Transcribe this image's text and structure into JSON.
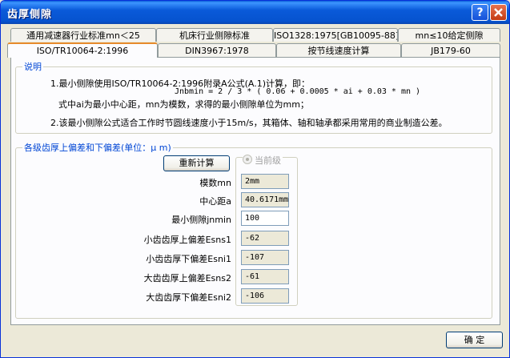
{
  "window": {
    "title": "齿厚侧隙"
  },
  "tabs": {
    "row1": [
      "通用减速器行业标准mn＜25",
      "机床行业侧隙标准",
      "ISO1328:1975[GB10095-88]",
      "mn≤10给定侧隙"
    ],
    "row2": [
      "ISO/TR10064-2:1996",
      "DIN3967:1978",
      "按节线速度计算",
      "JB179-60"
    ]
  },
  "notes": {
    "group_title": "说明",
    "line1": "1.最小侧隙使用ISO/TR10064-2:1996附录A公式(A.1)计算，即：",
    "formula": "Jnbmin = 2 / 3 * ( 0.06 + 0.0005 * ai + 0.03 * mn )",
    "line2": "式中ai为最小中心距，mn为模数，求得的最小侧隙单位为mm；",
    "line3": "2.该最小侧隙公式适合工作时节圆线速度小于15m/s，其箱体、轴和轴承都采用常用的商业制造公差。"
  },
  "deviation": {
    "group_title": "各级齿厚上偏差和下偏差(单位：μ m)",
    "recalc_button": "重新计算",
    "radio_label": "当前级",
    "fields": [
      {
        "label": "模数mn",
        "value": "2mm",
        "editable": false
      },
      {
        "label": "中心距a",
        "value": "40.6171mm",
        "editable": false
      },
      {
        "label": "最小侧隙jnmin",
        "value": "100",
        "editable": true
      },
      {
        "label": "小齿齿厚上偏差Esns1",
        "value": "-62",
        "editable": false
      },
      {
        "label": "小齿齿厚下偏差Esni1",
        "value": "-107",
        "editable": false
      },
      {
        "label": "大齿齿厚上偏差Esns2",
        "value": "-61",
        "editable": false
      },
      {
        "label": "大齿齿厚下偏差Esni2",
        "value": "-106",
        "editable": false
      }
    ]
  },
  "footer": {
    "ok_button": "确    定"
  },
  "colors": {
    "title_bar": "#0a5ad9",
    "group_title": "#0046d5",
    "active_tab_accent": "#e68b2c"
  }
}
